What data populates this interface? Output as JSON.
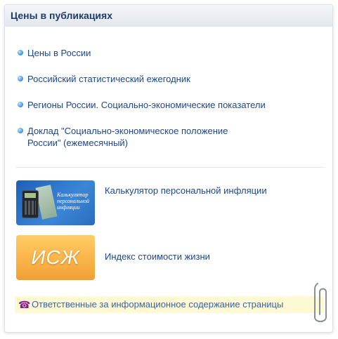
{
  "header": {
    "title": "Цены в публикациях"
  },
  "links": [
    {
      "label": "Цены в России"
    },
    {
      "label": "Российский статистический ежегодник"
    },
    {
      "label": "Регионы России. Социально-экономические показатели"
    },
    {
      "label": "Доклад \"Социально-экономическое положение России\" (ежемесячный)"
    }
  ],
  "tiles": {
    "calculator": {
      "caption": "Калькулятор персональной инфляции",
      "label": "Калькулятор персональной инфляции"
    },
    "isg": {
      "caption": "ИСЖ",
      "label": "Индекс стоимости жизни"
    }
  },
  "footer": {
    "label": "Ответственные за информационное содержание страницы"
  },
  "icons": {
    "bullet": "bullet-icon",
    "phone": "phone-icon",
    "clip": "paperclip-icon"
  },
  "colors": {
    "link": "#1b4690",
    "header_text": "#1f3b6e",
    "footer_bg": "#fdf9d3"
  }
}
